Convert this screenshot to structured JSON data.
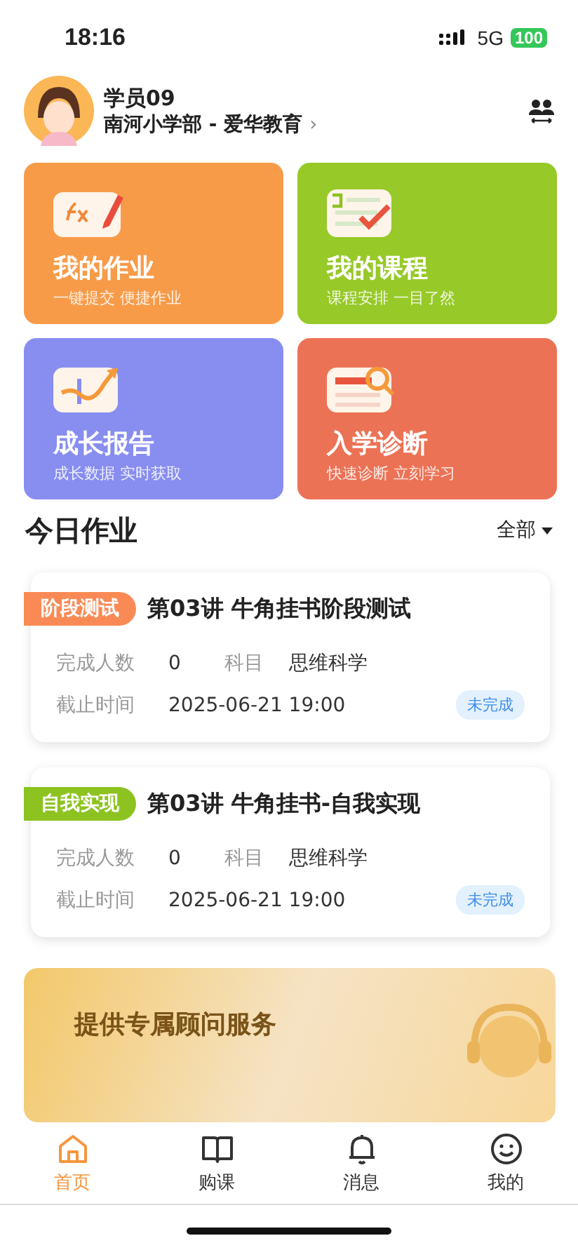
{
  "status_bar": {
    "time": "18:16",
    "network": "5G",
    "battery": "100"
  },
  "profile": {
    "name": "学员09",
    "org": "南河小学部 - 爱华教育",
    "chevron": "›"
  },
  "tiles": [
    {
      "kind": "homework",
      "title": "我的作业",
      "subtitle": "一键提交 便捷作业",
      "color": "#f89b49"
    },
    {
      "kind": "course",
      "title": "我的课程",
      "subtitle": "课程安排 一目了然",
      "color": "#97c928"
    },
    {
      "kind": "report",
      "title": "成长报告",
      "subtitle": "成长数据 实时获取",
      "color": "#888df0"
    },
    {
      "kind": "test",
      "title": "入学诊断",
      "subtitle": "快速诊断 立刻学习",
      "color": "#ec7255"
    }
  ],
  "today": {
    "title": "今日作业",
    "filter": "全部"
  },
  "assignments": [
    {
      "tag": "阶段测试",
      "color": "#fa8a55",
      "title": "第03讲 牛角挂书阶段测试",
      "count_label": "完成人数",
      "count": "0",
      "subject_label": "科目",
      "subject": "思维科学",
      "deadline_label": "截止时间",
      "deadline": "2025-06-21 19:00",
      "status": "未完成"
    },
    {
      "tag": "自我实现",
      "color": "#8cc320",
      "title": "第03讲 牛角挂书-自我实现",
      "count_label": "完成人数",
      "count": "0",
      "subject_label": "科目",
      "subject": "思维科学",
      "deadline_label": "截止时间",
      "deadline": "2025-06-21 19:00",
      "status": "未完成"
    }
  ],
  "banner": {
    "title": "提供专属顾问服务"
  },
  "tabs": [
    {
      "kind": "home",
      "label": "首页",
      "selected": true
    },
    {
      "kind": "book",
      "label": "购课",
      "selected": false
    },
    {
      "kind": "bell",
      "label": "消息",
      "selected": false
    },
    {
      "kind": "smile",
      "label": "我的",
      "selected": false
    }
  ]
}
